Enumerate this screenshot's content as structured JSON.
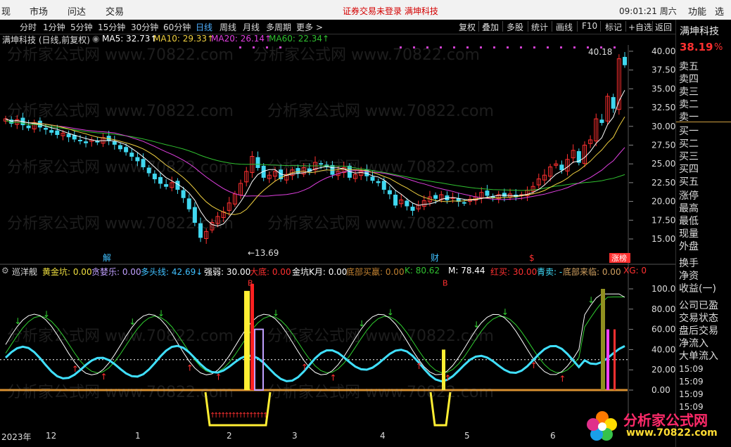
{
  "menu": {
    "left_items": [
      "现",
      "市场",
      "问达",
      "交易"
    ],
    "notice": "证券交易未登录  满坤科技",
    "clock": "09:01:21 周六",
    "right_items": [
      "功能",
      "选"
    ]
  },
  "periods": [
    "分时",
    "1分钟",
    "5分钟",
    "15分钟",
    "30分钟",
    "60分钟",
    "日线",
    "周线",
    "月线",
    "多周期",
    "更多 >"
  ],
  "active_period": "日线",
  "tools": [
    "复权",
    "叠加",
    "多股",
    "统计",
    "画线",
    "F10",
    "标记",
    "+自选",
    "返回"
  ],
  "main_header": {
    "title": "满坤科技 (日线,前复权)",
    "ma5": "MA5: 32.73↑",
    "ma10": "MA10: 29.33↑",
    "ma20": "MA20: 26.14↑",
    "ma60": "MA60: 22.34↑"
  },
  "colors": {
    "ma5": "#ffffff",
    "ma10": "#f0d040",
    "ma20": "#e040e0",
    "ma60": "#30c030",
    "up": "#ff3030",
    "down": "#40d8f0",
    "cyanline": "#40e0ff"
  },
  "sidebar": {
    "title": "满坤科技",
    "price": "38.19",
    "pct": "%",
    "sells": [
      "卖五",
      "卖四",
      "卖三",
      "卖二",
      "卖一"
    ],
    "buys": [
      "买一",
      "买二",
      "买三",
      "买四",
      "买五"
    ],
    "stats": [
      "涨停",
      "最高",
      "最低",
      "现量",
      "外盘"
    ],
    "lower": [
      "换手",
      "净资",
      "收益(一)",
      "公司已盈",
      "交易状态",
      "盘后交易",
      "净流入",
      "大单流入"
    ],
    "times": [
      "15:09",
      "15:09",
      "15:09",
      "15:09"
    ]
  },
  "main_axis": {
    "ticks": [
      "40.00",
      "37.50",
      "35.00",
      "32.50",
      "30.00",
      "27.50",
      "25.00",
      "22.50",
      "20.00",
      "17.50",
      "15.00"
    ],
    "high_label": "40.18",
    "low_label": "13.69"
  },
  "main_markers": [
    "解",
    "财",
    "$",
    "涨榜"
  ],
  "sub_header": {
    "name": "巡洋舰",
    "items": [
      "黄金坑: 0.00",
      "贪婪乐: 0.00",
      "多头线: 42.69↓",
      "强弱: 30.00",
      "大底: 0.00",
      "金坑K月: 0.00",
      "底部买羸: 0.00",
      "K: 80.62",
      "M: 78.44",
      "红买: 30.00",
      "青卖: -",
      "底部来临: 0.00",
      "XG: 0"
    ]
  },
  "sub_axis": {
    "ticks": [
      "100.00",
      "80.00",
      "60.00",
      "40.00",
      "20.00",
      "0.00"
    ]
  },
  "sub_marks": [
    "B",
    "B"
  ],
  "xaxis": [
    "2023年",
    "12",
    "1",
    "2",
    "3",
    "4",
    "5",
    "6"
  ],
  "watermark": "分析家公式网 www.70822.com",
  "logo": {
    "name": "分析家公式网",
    "url": "www.70822.com"
  },
  "chart_data": {
    "type": "candlestick",
    "ylim": [
      13.69,
      40.18
    ],
    "closes": [
      31.0,
      30.4,
      30.9,
      30.2,
      29.8,
      30.5,
      29.9,
      29.6,
      29.2,
      28.9,
      29.1,
      28.6,
      28.3,
      28.1,
      27.8,
      28.2,
      27.9,
      28.5,
      28.1,
      27.6,
      27.0,
      26.6,
      26.0,
      25.4,
      24.6,
      23.8,
      23.0,
      22.4,
      22.0,
      22.5,
      21.6,
      20.5,
      19.0,
      17.2,
      15.2,
      16.0,
      17.2,
      18.0,
      18.6,
      19.8,
      21.0,
      22.4,
      24.0,
      26.0,
      24.5,
      23.2,
      23.5,
      24.0,
      23.0,
      23.6,
      24.2,
      23.8,
      24.5,
      24.0,
      25.2,
      25.0,
      24.6,
      23.6,
      24.0,
      24.5,
      23.2,
      23.6,
      24.0,
      23.4,
      22.8,
      22.5,
      21.6,
      21.0,
      19.5,
      20.2,
      19.4,
      18.8,
      19.5,
      20.1,
      20.6,
      20.4,
      20.9,
      20.2,
      20.5,
      20.0,
      19.8,
      20.3,
      20.6,
      21.2,
      20.8,
      20.5,
      20.9,
      20.7,
      21.0,
      20.6,
      20.9,
      21.5,
      22.0,
      23.0,
      23.5,
      24.6,
      25.0,
      24.2,
      25.6,
      26.8,
      25.2,
      27.5,
      28.2,
      31.0,
      30.5,
      34.0,
      32.4,
      39.0,
      38.19
    ]
  }
}
